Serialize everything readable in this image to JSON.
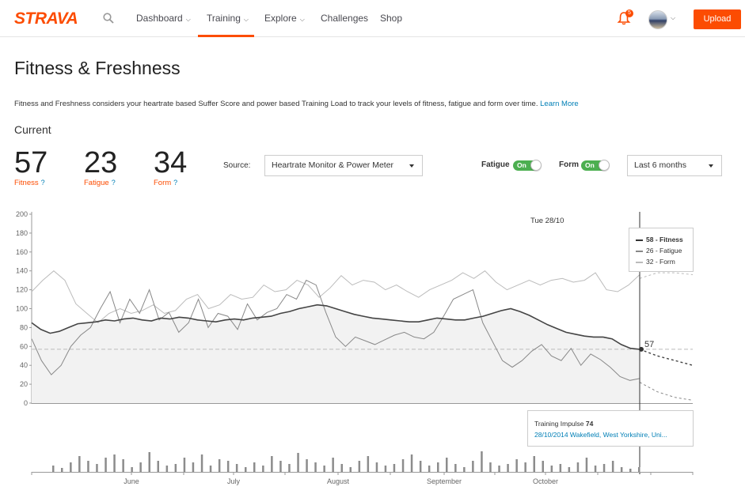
{
  "nav": {
    "logo": "STRAVA",
    "items": [
      {
        "label": "Dashboard",
        "dropdown": true
      },
      {
        "label": "Training",
        "dropdown": true,
        "active": true
      },
      {
        "label": "Explore",
        "dropdown": true
      },
      {
        "label": "Challenges",
        "dropdown": false
      },
      {
        "label": "Shop",
        "dropdown": false
      }
    ],
    "notification_count": "5",
    "upload_label": "Upload",
    "accent": "#fc4c02"
  },
  "page": {
    "title": "Fitness & Freshness",
    "intro": "Fitness and Freshness considers your heartrate based Suffer Score and power based Training Load to track your levels of fitness, fatigue and form over time.",
    "learn_more": "Learn More",
    "current_label": "Current"
  },
  "stats": [
    {
      "value": "57",
      "label": "Fitness",
      "help": "?"
    },
    {
      "value": "23",
      "label": "Fatigue",
      "help": "?"
    },
    {
      "value": "34",
      "label": "Form",
      "help": "?"
    }
  ],
  "controls": {
    "source_label": "Source:",
    "source_value": "Heartrate Monitor & Power Meter",
    "fatigue_label": "Fatigue",
    "form_label": "Form",
    "toggle_on": "On",
    "range_value": "Last 6 months"
  },
  "tooltip": {
    "date": "Tue 28/10",
    "rows": [
      {
        "text": "58 - Fitness",
        "color": "#333333"
      },
      {
        "text": "26 - Fatigue",
        "color": "#888888"
      },
      {
        "text": "32 - Form",
        "color": "#bbbbbb"
      }
    ],
    "current_value": "57"
  },
  "impulse": {
    "label": "Training Impulse",
    "value": "74",
    "activity": "28/10/2014 Wakefield, West Yorkshire, Uni..."
  },
  "chart_data": {
    "type": "line",
    "y_ticks": [
      0,
      20,
      40,
      60,
      80,
      100,
      120,
      140,
      160,
      180,
      200
    ],
    "ylim": [
      0,
      200
    ],
    "x_months": [
      "June",
      "July",
      "August",
      "September",
      "October"
    ],
    "series": [
      {
        "name": "Fitness",
        "color": "#444444",
        "values": [
          85,
          78,
          74,
          76,
          80,
          84,
          85,
          86,
          88,
          87,
          89,
          90,
          88,
          87,
          90,
          89,
          91,
          90,
          88,
          87,
          86,
          88,
          89,
          88,
          90,
          91,
          92,
          95,
          97,
          100,
          102,
          104,
          103,
          100,
          97,
          94,
          92,
          90,
          89,
          88,
          87,
          86,
          86,
          88,
          90,
          89,
          88,
          88,
          90,
          92,
          95,
          98,
          100,
          97,
          93,
          88,
          83,
          79,
          75,
          73,
          71,
          70,
          70,
          68,
          62,
          58,
          57
        ]
      },
      {
        "name": "Fatigue",
        "color": "#888888",
        "values": [
          68,
          45,
          30,
          40,
          60,
          72,
          80,
          100,
          118,
          85,
          110,
          95,
          120,
          88,
          96,
          75,
          85,
          110,
          80,
          95,
          92,
          78,
          105,
          88,
          96,
          100,
          115,
          110,
          130,
          125,
          96,
          70,
          60,
          70,
          66,
          62,
          67,
          72,
          75,
          70,
          68,
          75,
          92,
          110,
          115,
          120,
          85,
          65,
          45,
          38,
          45,
          55,
          62,
          50,
          45,
          58,
          40,
          52,
          46,
          38,
          28,
          24,
          26
        ]
      },
      {
        "name": "Form",
        "color": "#bbbbbb",
        "values": [
          118,
          130,
          140,
          130,
          105,
          95,
          85,
          95,
          100,
          95,
          98,
          104,
          95,
          98,
          110,
          115,
          100,
          104,
          115,
          110,
          112,
          125,
          118,
          120,
          130,
          125,
          112,
          122,
          135,
          125,
          130,
          128,
          120,
          125,
          118,
          112,
          120,
          125,
          130,
          138,
          132,
          140,
          128,
          120,
          125,
          130,
          125,
          130,
          132,
          128,
          130,
          138,
          120,
          118,
          125,
          136
        ]
      },
      {
        "name": "Fitness projection",
        "color": "#444444",
        "dashed": true,
        "values": [
          57,
          50,
          45,
          40
        ]
      },
      {
        "name": "Fatigue projection",
        "color": "#888888",
        "dashed": true,
        "values": [
          22,
          12,
          6,
          3
        ]
      },
      {
        "name": "Form projection",
        "color": "#bbbbbb",
        "dashed": true,
        "values": [
          132,
          138,
          138,
          136
        ]
      }
    ],
    "training_impulse": [
      8,
      5,
      12,
      20,
      14,
      10,
      18,
      22,
      16,
      6,
      12,
      25,
      14,
      8,
      10,
      18,
      12,
      22,
      8,
      16,
      14,
      10,
      6,
      12,
      8,
      20,
      14,
      10,
      24,
      16,
      12,
      8,
      18,
      10,
      6,
      14,
      20,
      12,
      8,
      10,
      16,
      22,
      14,
      8,
      12,
      18,
      10,
      6,
      14,
      26,
      12,
      8,
      10,
      16,
      12,
      20,
      14,
      8,
      10,
      6,
      12,
      18,
      8,
      10,
      14,
      6,
      4,
      6
    ]
  }
}
